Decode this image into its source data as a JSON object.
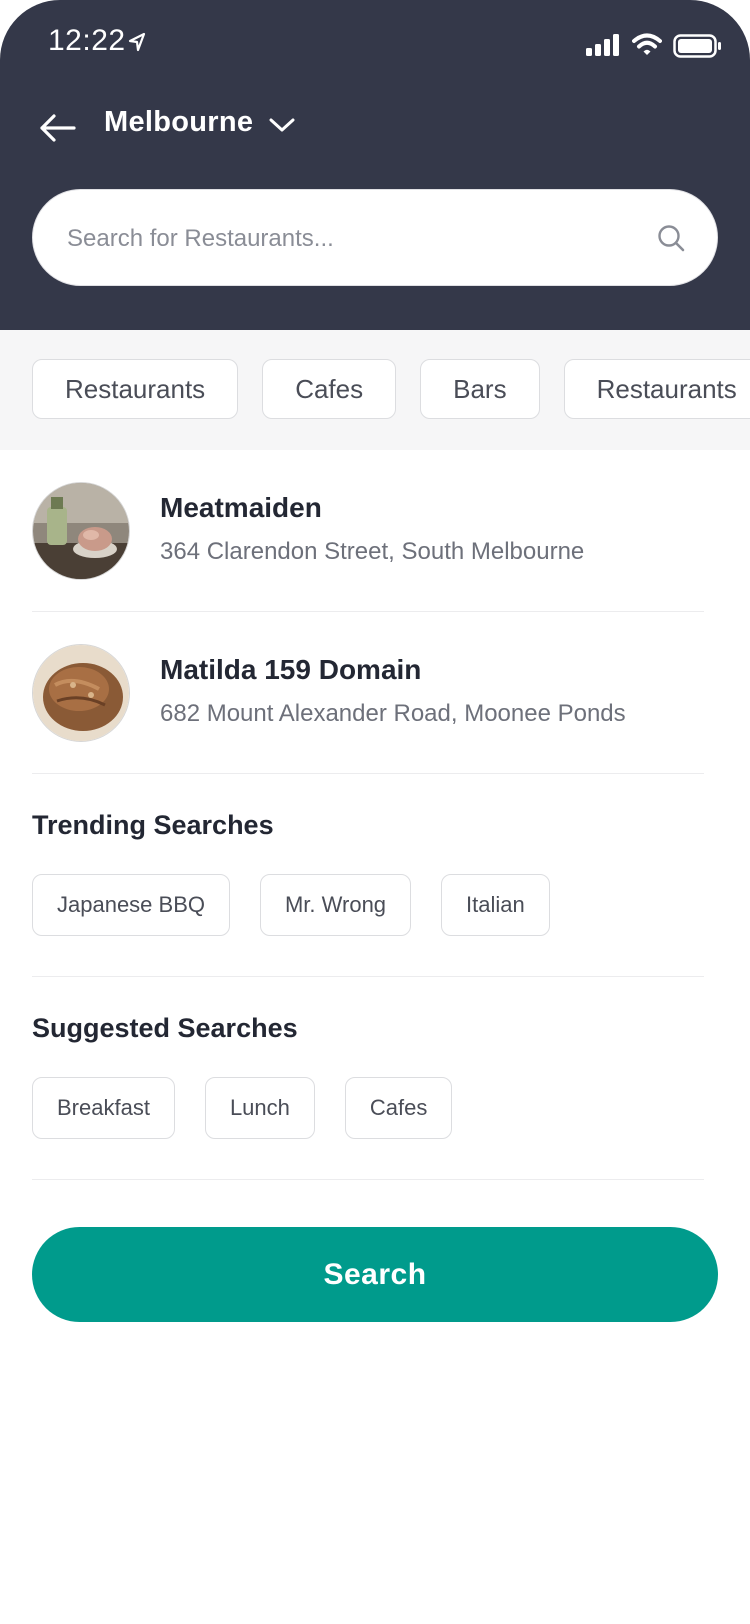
{
  "status_bar": {
    "time": "12:22",
    "icons": [
      "location-arrow-icon",
      "signal-icon",
      "wifi-icon",
      "battery-icon"
    ]
  },
  "header": {
    "back_icon": "back-arrow-icon",
    "city": "Melbourne",
    "city_dropdown_icon": "chevron-down-icon"
  },
  "search": {
    "placeholder": "Search for Restaurants...",
    "icon": "search-icon"
  },
  "categories": [
    "Restaurants",
    "Cafes",
    "Bars",
    "Restaurants"
  ],
  "results": [
    {
      "name": "Meatmaiden",
      "address": "364 Clarendon Street, South Melbourne",
      "thumbnail": "food-photo"
    },
    {
      "name": "Matilda 159 Domain",
      "address": "682 Mount Alexander Road, Moonee Ponds",
      "thumbnail": "bread-photo"
    }
  ],
  "trending": {
    "title": "Trending Searches",
    "tags": [
      "Japanese BBQ",
      "Mr. Wrong",
      "Italian"
    ]
  },
  "suggested": {
    "title": "Suggested Searches",
    "tags": [
      "Breakfast",
      "Lunch",
      "Cafes"
    ]
  },
  "actions": {
    "search_button": "Search"
  },
  "colors": {
    "header_bg": "#343849",
    "accent": "#009b8c",
    "band_bg": "#f6f6f7"
  }
}
